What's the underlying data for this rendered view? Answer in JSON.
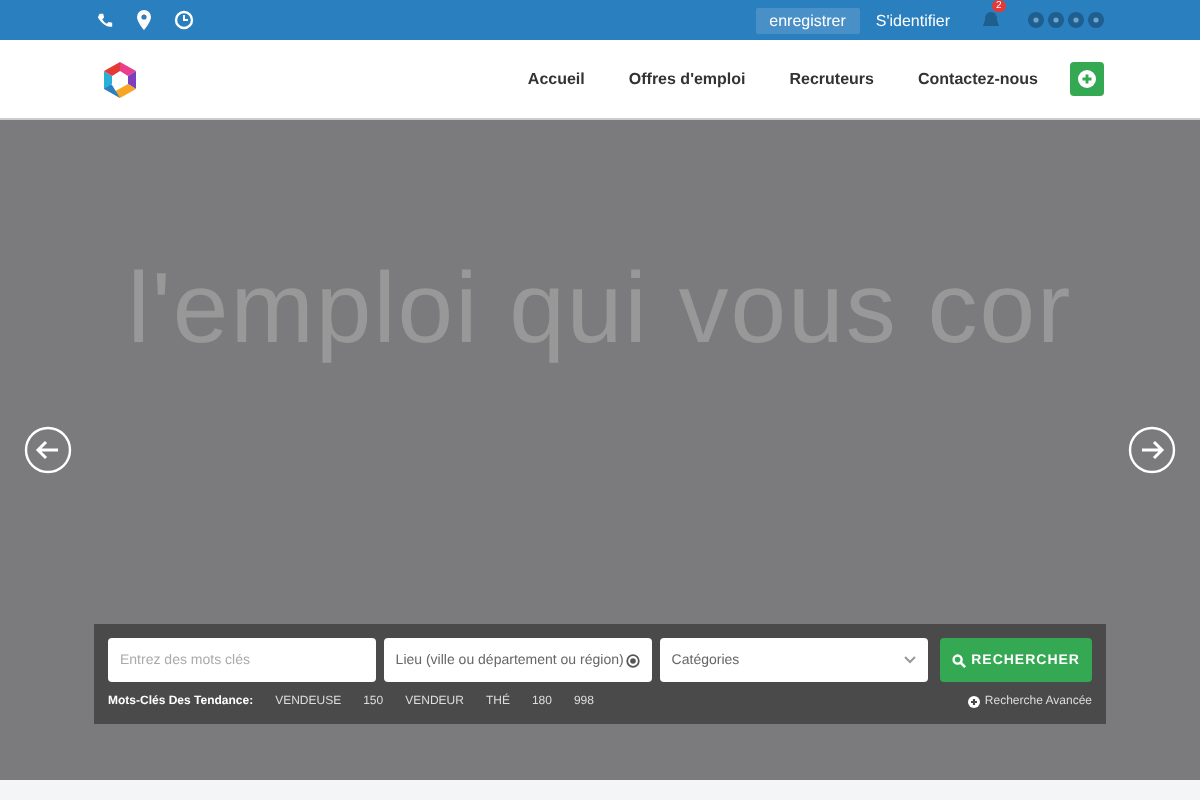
{
  "top_bar": {
    "register": "enregistrer",
    "login": "S'identifier",
    "notification_count": "2"
  },
  "nav": {
    "items": [
      {
        "label": "Accueil"
      },
      {
        "label": "Offres d'emploi"
      },
      {
        "label": "Recruteurs"
      },
      {
        "label": "Contactez-nous"
      }
    ]
  },
  "hero": {
    "headline": "l'emploi qui vous cor"
  },
  "search": {
    "keywords_placeholder": "Entrez des mots clés",
    "location_placeholder": "Lieu (ville ou département ou région)",
    "category": "Catégories",
    "button": "RECHERCHER",
    "trending_label": "Mots-Clés Des Tendance:",
    "trending": [
      "VENDEUSE",
      "150",
      "VENDEUR",
      "THÉ",
      "180",
      "998"
    ],
    "advanced": "Recherche Avancée"
  }
}
